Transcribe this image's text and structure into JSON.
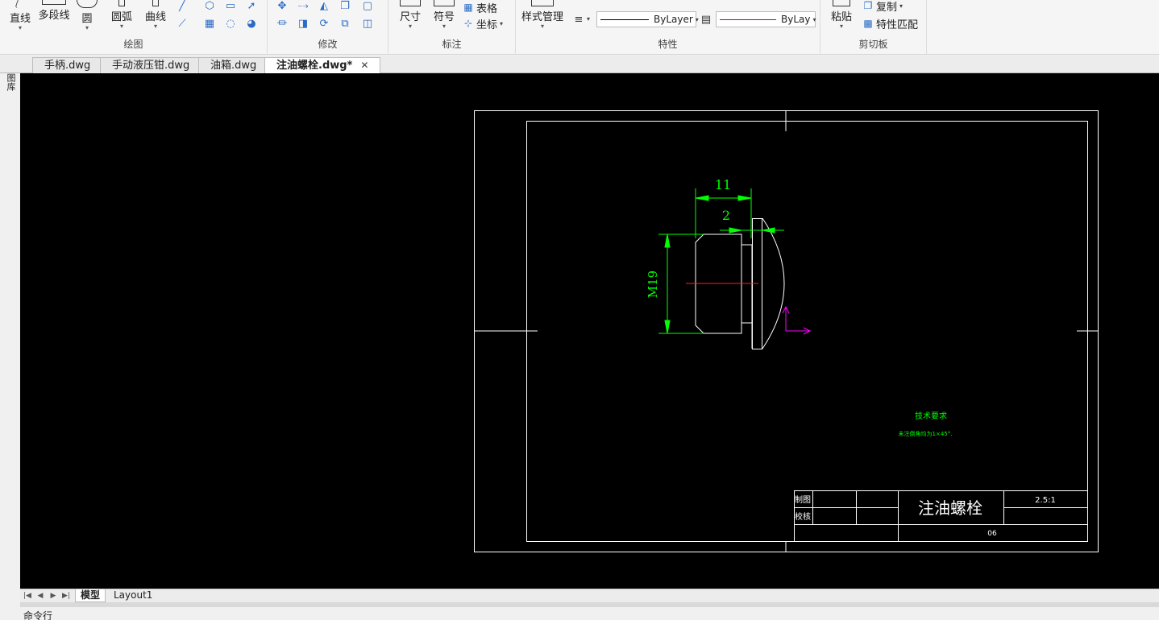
{
  "ribbon": {
    "draw_panel": {
      "label": "绘图",
      "buttons": {
        "line": "直线",
        "polyline": "多段线",
        "circle": "圆",
        "arc": "圆弧",
        "curve": "曲线"
      }
    },
    "modify_panel": {
      "label": "修改"
    },
    "annotate_panel": {
      "label": "标注",
      "buttons": {
        "dimension": "尺寸",
        "symbol": "符号",
        "table": "表格",
        "coordinate": "坐标"
      }
    },
    "properties_panel": {
      "label": "特性",
      "style_manager": "样式管理",
      "linetype": "ByLayer",
      "color": "ByLay"
    },
    "clipboard_panel": {
      "label": "剪切板",
      "paste": "粘贴",
      "copy": "复制",
      "match_props": "特性匹配"
    }
  },
  "left_strip": {
    "label": "图库"
  },
  "tabs": [
    {
      "label": "手柄.dwg"
    },
    {
      "label": "手动液压钳.dwg"
    },
    {
      "label": "油箱.dwg"
    },
    {
      "label": "注油螺栓.dwg*",
      "close": "✕"
    }
  ],
  "drawing": {
    "dim_length": "11",
    "dim_step": "2",
    "dim_thread": "M19",
    "tech_title": "技术要求",
    "tech_note": "未注倒角均为1×45°.",
    "title_block": {
      "drawn_label": "制图",
      "check_label": "校核",
      "part_name": "注油螺栓",
      "scale": "2.5:1",
      "number": "06"
    },
    "colors": {
      "background": "#000000",
      "frame": "#ffffff",
      "dimension": "#00ff00",
      "centerline": "#ff0000",
      "ucs": "#ff00ff"
    }
  },
  "layout_tabs": [
    {
      "label": "模型"
    },
    {
      "label": "Layout1"
    }
  ],
  "command_line": {
    "label": "命令行"
  }
}
